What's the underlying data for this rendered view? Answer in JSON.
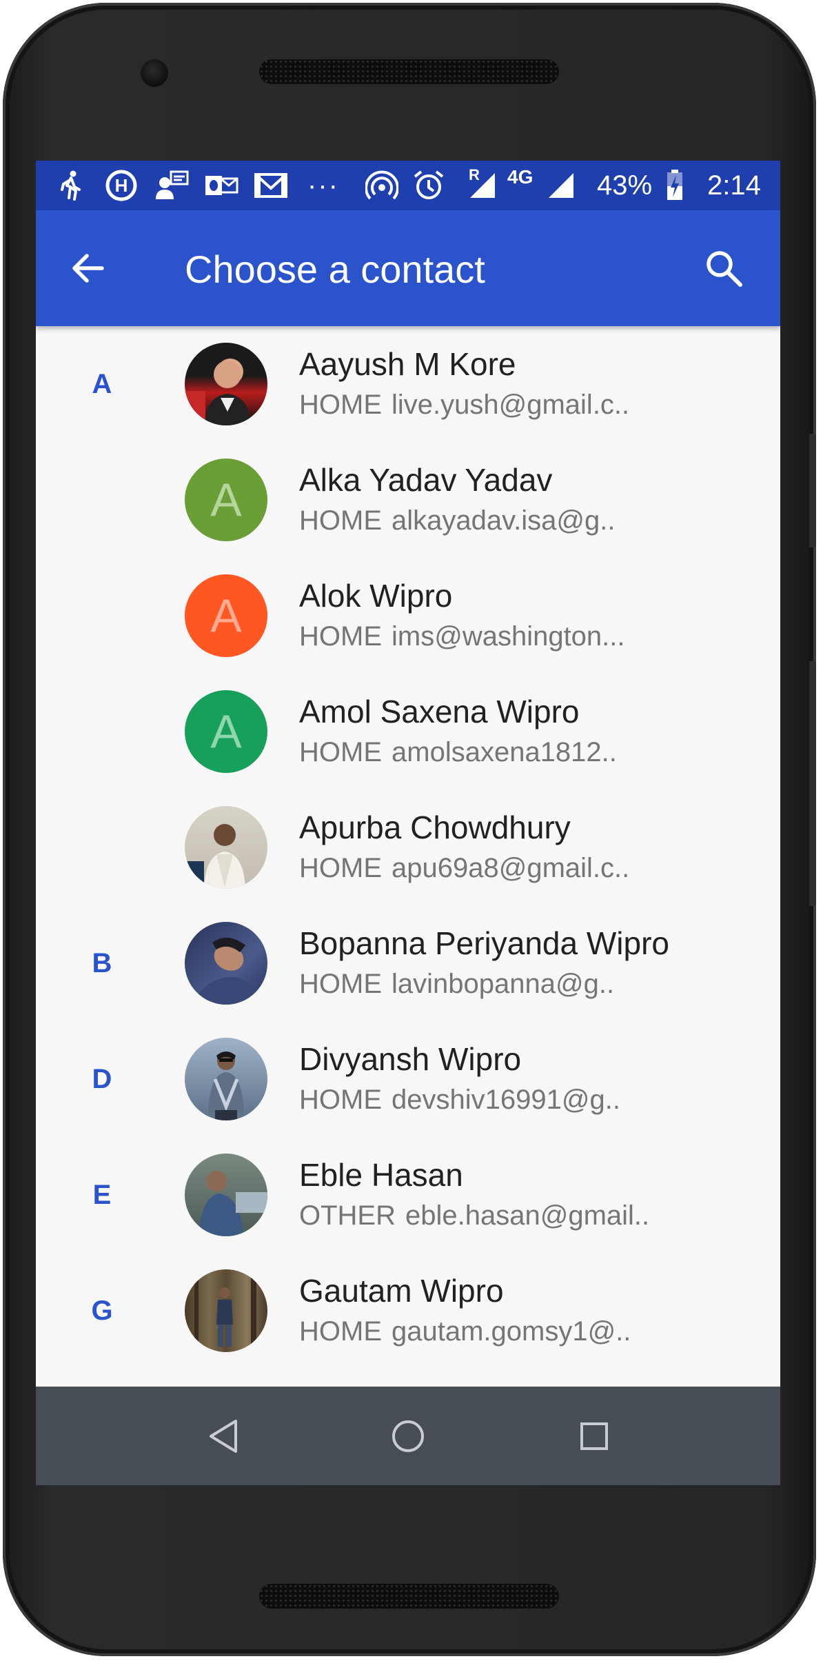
{
  "status_bar": {
    "battery_text": "43%",
    "time": "2:14",
    "network_label": "4G",
    "roaming_label": "R",
    "overflow": "···",
    "icons": [
      "walking-icon",
      "hike-icon",
      "contact-card-icon",
      "outlook-icon",
      "gmail-icon",
      "overflow-dots",
      "hotspot-icon",
      "alarm-icon",
      "signal-roaming-icon",
      "signal-4g-icon",
      "battery-charging-icon"
    ]
  },
  "app_bar": {
    "title": "Choose a contact",
    "back_icon": "arrow-back-icon",
    "search_icon": "search-icon",
    "background": "#2b53cc"
  },
  "contacts": [
    {
      "letter": "A",
      "name": "Aayush M Kore",
      "type": "HOME",
      "value": "live.yush@gmail.c..",
      "avatar": "photo",
      "avatar_color": "#5a1b1b"
    },
    {
      "letter": "",
      "name": "Alka Yadav Yadav",
      "type": "HOME",
      "value": "alkayadav.isa@g..",
      "avatar": "initial",
      "initial": "A",
      "avatar_color": "#6a9e37"
    },
    {
      "letter": "",
      "name": "Alok Wipro",
      "type": "HOME",
      "value": "ims@washington...",
      "avatar": "initial",
      "initial": "A",
      "avatar_color": "#ff5722"
    },
    {
      "letter": "",
      "name": "Amol Saxena Wipro",
      "type": "HOME",
      "value": "amolsaxena1812..",
      "avatar": "initial",
      "initial": "A",
      "avatar_color": "#16a05a"
    },
    {
      "letter": "",
      "name": "Apurba Chowdhury",
      "type": "HOME",
      "value": "apu69a8@gmail.c..",
      "avatar": "photo",
      "avatar_color": "#c9c3b8"
    },
    {
      "letter": "B",
      "name": "Bopanna Periyanda Wipro",
      "type": "HOME",
      "value": "lavinbopanna@g..",
      "avatar": "photo",
      "avatar_color": "#3b4670"
    },
    {
      "letter": "D",
      "name": "Divyansh Wipro",
      "type": "HOME",
      "value": "devshiv16991@g..",
      "avatar": "photo",
      "avatar_color": "#6a7d93"
    },
    {
      "letter": "E",
      "name": "Eble Hasan",
      "type": "OTHER",
      "value": "eble.hasan@gmail..",
      "avatar": "photo",
      "avatar_color": "#5c6a62"
    },
    {
      "letter": "G",
      "name": "Gautam Wipro",
      "type": "HOME",
      "value": "gautam.gomsy1@..",
      "avatar": "photo",
      "avatar_color": "#5e4a34"
    }
  ],
  "nav_bar": {
    "back_icon": "nav-back-icon",
    "home_icon": "nav-home-icon",
    "recents_icon": "nav-recents-icon",
    "background": "#474d54"
  }
}
